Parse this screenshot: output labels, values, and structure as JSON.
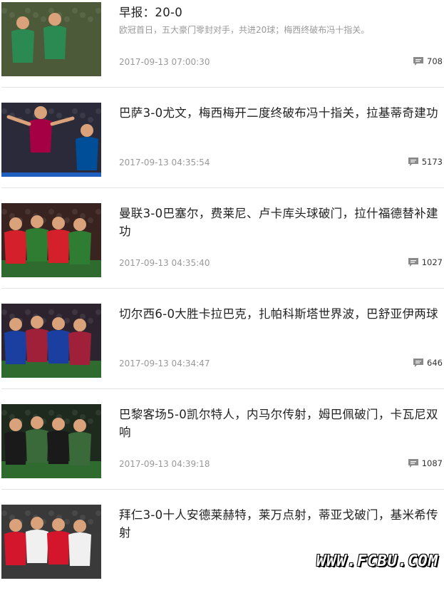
{
  "articles": [
    {
      "title": "早报：20-0",
      "summary": "欧冠首日，五大豪门零封对手，共进20球；梅西终破布冯十指关。",
      "time": "2017-09-13 07:00:30",
      "comments": "708",
      "thumb": "buffon-embrace-thumbnail",
      "colors": {
        "bg": "#4c5a3a",
        "jersey": "#2b8a52",
        "accent": "#1a2b63"
      }
    },
    {
      "title": "巴萨3-0尤文，梅西梅开二度终破布冯十指关，拉基蒂奇建功",
      "summary": "",
      "time": "2017-09-13 04:35:54",
      "comments": "5173",
      "thumb": "messi-celebration-thumbnail",
      "colors": {
        "bg": "#2a2a3a",
        "jersey": "#a50044",
        "accent": "#004d98"
      }
    },
    {
      "title": "曼联3-0巴塞尔，费莱尼、卢卡库头球破门，拉什福德替补建功",
      "summary": "",
      "time": "2017-09-13 04:35:40",
      "comments": "1027",
      "thumb": "man-united-players-thumbnail",
      "colors": {
        "bg": "#3a2420",
        "jersey": "#d4202a",
        "accent": "#2e7d32"
      }
    },
    {
      "title": "切尔西6-0大胜卡拉巴克，扎帕科斯塔世界波，巴舒亚伊两球",
      "summary": "",
      "time": "2017-09-13 04:34:47",
      "comments": "646",
      "thumb": "chelsea-players-thumbnail",
      "colors": {
        "bg": "#2c2430",
        "jersey": "#1b3fa0",
        "accent": "#a0203a"
      }
    },
    {
      "title": "巴黎客场5-0凯尔特人，内马尔传射，姆巴佩破门，卡瓦尼双响",
      "summary": "",
      "time": "2017-09-13 04:39:18",
      "comments": "1087",
      "thumb": "psg-neymar-thumbnail",
      "colors": {
        "bg": "#1e2a1e",
        "jersey": "#1a1a1a",
        "accent": "#3a6a3a"
      }
    },
    {
      "title": "拜仁3-0十人安德莱赫特，莱万点射，蒂亚戈破门，基米希传射",
      "summary": "",
      "time": "",
      "comments": "",
      "thumb": "bayern-players-thumbnail",
      "colors": {
        "bg": "#3a3a3a",
        "jersey": "#d3162c",
        "accent": "#f0f0f0"
      }
    }
  ],
  "watermark": "WWW.FCBU.COM",
  "icons": {
    "comment": "comment-bubble-icon"
  }
}
